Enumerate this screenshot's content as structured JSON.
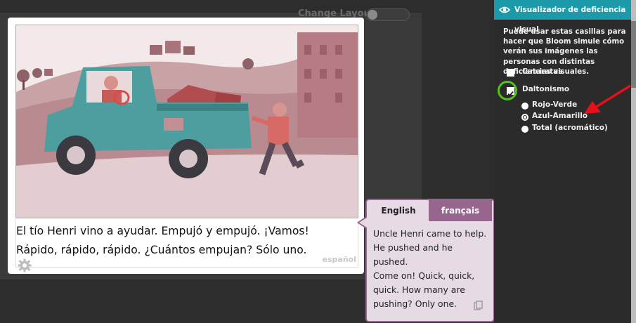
{
  "topbar": {
    "layout_label": "Change Layout"
  },
  "page": {
    "vernacular_text": "El tío Henri vino a ayudar. Empujó y empujó. ¡Vamos!\nRápido, rápido, rápido. ¿Cuántos empujan? Sólo uno.",
    "language_tag": "español",
    "settings_icon": "gear-icon"
  },
  "bubble": {
    "tabs": [
      {
        "label": "English",
        "active": true
      },
      {
        "label": "français",
        "active": false
      }
    ],
    "text": "Uncle Henri came to help.\nHe pushed and he pushed.\nCome on! Quick, quick,\nquick. How many are\npushing? Only one.",
    "copy_icon": "copy-icon"
  },
  "panel": {
    "title": "Visualizador de deficiencia visual",
    "title_icon": "eye-icon",
    "description": "Puede usar estas casillas para hacer que Bloom simule cómo verán sus imágenes las personas con distintas deficiencias visuales.",
    "checkboxes": [
      {
        "label": "Cataratas",
        "checked": false
      },
      {
        "label": "Daltonismo",
        "checked": true
      }
    ],
    "radios": [
      {
        "label": "Rojo-Verde",
        "selected": false
      },
      {
        "label": "Azul-Amarillo",
        "selected": true
      },
      {
        "label": "Total (acromático)",
        "selected": false
      }
    ]
  },
  "colors": {
    "accent_teal": "#1d9aa9",
    "bubble_purple": "#96668f",
    "highlight_green": "#55c21b",
    "annotation_red": "#e4111b"
  }
}
